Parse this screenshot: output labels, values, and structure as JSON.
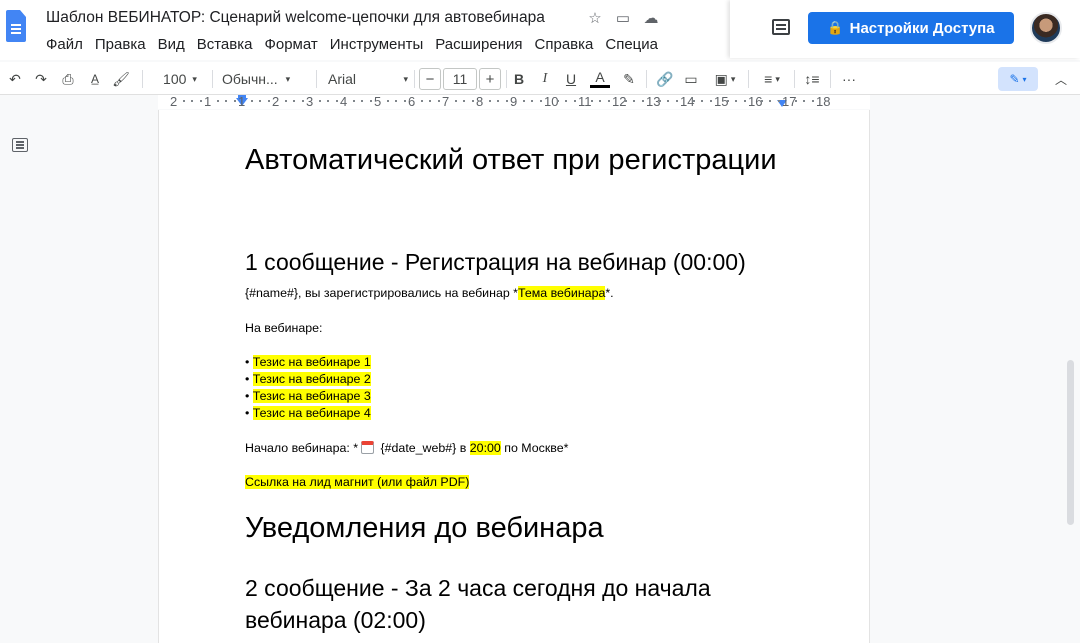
{
  "header": {
    "doc_title": "Шаблон ВЕБИНАТОР: Сценарий welcome-цепочки для автовебинара",
    "menu": [
      "Файл",
      "Правка",
      "Вид",
      "Вставка",
      "Формат",
      "Инструменты",
      "Расширения",
      "Справка",
      "Специа"
    ],
    "share_label": "Настройки Доступа",
    "icons": [
      "star-icon",
      "move-to-folder-icon",
      "cloud-status-icon",
      "comment-icon",
      "lock-icon",
      "avatar"
    ]
  },
  "toolbar": {
    "zoom": "100",
    "style": "Обычн...",
    "font": "Arial",
    "font_size": "11",
    "minus": "−",
    "plus": "+",
    "bold": "B",
    "italic": "I",
    "underline": "U",
    "text_color": "A",
    "more": "···",
    "icons": [
      "undo-icon",
      "redo-icon",
      "print-icon",
      "spellcheck-icon",
      "paint-format-icon",
      "highlight-icon",
      "link-icon",
      "add-comment-icon",
      "insert-image-icon",
      "align-icon",
      "line-spacing-icon",
      "editing-mode-icon",
      "collapse-icon"
    ]
  },
  "ruler": {
    "labels": [
      "2",
      "1",
      "1",
      "2",
      "3",
      "4",
      "5",
      "6",
      "7",
      "8",
      "9",
      "10",
      "11",
      "12",
      "13",
      "14",
      "15",
      "16",
      "17",
      "18"
    ]
  },
  "document": {
    "heading1": "Автоматический ответ при регистрации",
    "message1_title": "1 сообщение - Регистрация на вебинар (00:00)",
    "line1_a": "{#name#}, вы зарегистрировались на вебинар *",
    "line1_hl": "Тема вебинара",
    "line1_b": "*.",
    "on_webinar": "На вебинаре:",
    "bullet": "• ",
    "theses": [
      "Тезис на вебинаре 1",
      "Тезис на вебинаре 2",
      "Тезис на вебинаре 3",
      "Тезис на вебинаре 4"
    ],
    "start_a": "Начало вебинара: *",
    "start_b": " {#date_web#} в ",
    "start_time": "20:00",
    "start_c": " по Москве*",
    "lead_magnet": "Ссылка на лид магнит (или файл PDF)",
    "heading2": "Уведомления до вебинара",
    "message2_title": "2 сообщение - За 2 часа сегодня до начала вебинара (02:00)"
  },
  "colors": {
    "accent": "#1a73e8",
    "highlight": "#ffff00",
    "doc_icon": "#4285f4"
  }
}
